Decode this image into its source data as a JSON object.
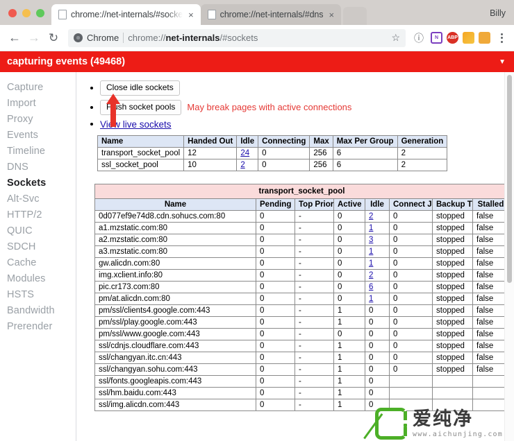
{
  "window": {
    "profile_name": "Billy",
    "traffic_lights": [
      "close",
      "minimize",
      "maximize"
    ]
  },
  "tabs": [
    {
      "title": "chrome://net-internals/#socke",
      "active": true,
      "close_label": "×"
    },
    {
      "title": "chrome://net-internals/#dns",
      "active": false,
      "close_label": "×"
    }
  ],
  "toolbar": {
    "back_icon": "←",
    "forward_icon": "→",
    "reload_icon": "↻",
    "omnibox": {
      "scheme_label": "Chrome",
      "url_prefix": "chrome://",
      "url_bold": "net-internals",
      "url_suffix": "/#sockets",
      "full_url": "chrome://net-internals/#sockets",
      "star_icon": "☆"
    },
    "info_icon": "ⓘ",
    "extensions": [
      {
        "name": "extension-purple",
        "label": "N",
        "color": "#7b3fbf"
      },
      {
        "name": "extension-adblock-plus",
        "label": "ABP",
        "color": "#d93025"
      },
      {
        "name": "extension-chart",
        "label": "",
        "color": "#f5a623"
      },
      {
        "name": "extension-pumpkin",
        "label": "",
        "color": "#f0a93a"
      }
    ],
    "menu_icon": "kebab-menu"
  },
  "banner": {
    "text": "capturing events (49468)",
    "caret": "▼",
    "color": "#ed1c16"
  },
  "sidebar": {
    "items": [
      {
        "label": "Capture",
        "active": false
      },
      {
        "label": "Import",
        "active": false
      },
      {
        "label": "Proxy",
        "active": false
      },
      {
        "label": "Events",
        "active": false
      },
      {
        "label": "Timeline",
        "active": false
      },
      {
        "label": "DNS",
        "active": false
      },
      {
        "label": "Sockets",
        "active": true
      },
      {
        "label": "Alt-Svc",
        "active": false
      },
      {
        "label": "HTTP/2",
        "active": false
      },
      {
        "label": "QUIC",
        "active": false
      },
      {
        "label": "SDCH",
        "active": false
      },
      {
        "label": "Cache",
        "active": false
      },
      {
        "label": "Modules",
        "active": false
      },
      {
        "label": "HSTS",
        "active": false
      },
      {
        "label": "Bandwidth",
        "active": false
      },
      {
        "label": "Prerender",
        "active": false
      }
    ]
  },
  "actions": {
    "close_idle_sockets": "Close idle sockets",
    "flush_socket_pools": "Flush socket pools",
    "flush_warning": "May break pages with active connections",
    "view_live_sockets": "View live sockets"
  },
  "pool_summary": {
    "headers": [
      "Name",
      "Handed Out",
      "Idle",
      "Connecting",
      "Max",
      "Max Per Group",
      "Generation"
    ],
    "rows": [
      {
        "name": "transport_socket_pool",
        "handed_out": "12",
        "idle": "24",
        "idle_link": true,
        "connecting": "0",
        "max": "256",
        "max_per_group": "6",
        "generation": "2"
      },
      {
        "name": "ssl_socket_pool",
        "handed_out": "10",
        "idle": "2",
        "idle_link": true,
        "connecting": "0",
        "max": "256",
        "max_per_group": "6",
        "generation": "2"
      }
    ]
  },
  "socket_table": {
    "caption": "transport_socket_pool",
    "headers": [
      "Name",
      "Pending",
      "Top Priority",
      "Active",
      "Idle",
      "Connect Jobs",
      "Backup Timer",
      "Stalled"
    ],
    "rows": [
      {
        "name": "0d077ef9e74d8.cdn.sohucs.com:80",
        "pending": "0",
        "top_priority": "-",
        "active": "0",
        "idle": "2",
        "idle_link": true,
        "connect_jobs": "0",
        "backup_timer": "stopped",
        "stalled": "false"
      },
      {
        "name": "a1.mzstatic.com:80",
        "pending": "0",
        "top_priority": "-",
        "active": "0",
        "idle": "1",
        "idle_link": true,
        "connect_jobs": "0",
        "backup_timer": "stopped",
        "stalled": "false"
      },
      {
        "name": "a2.mzstatic.com:80",
        "pending": "0",
        "top_priority": "-",
        "active": "0",
        "idle": "3",
        "idle_link": true,
        "connect_jobs": "0",
        "backup_timer": "stopped",
        "stalled": "false"
      },
      {
        "name": "a3.mzstatic.com:80",
        "pending": "0",
        "top_priority": "-",
        "active": "0",
        "idle": "1",
        "idle_link": true,
        "connect_jobs": "0",
        "backup_timer": "stopped",
        "stalled": "false"
      },
      {
        "name": "gw.alicdn.com:80",
        "pending": "0",
        "top_priority": "-",
        "active": "0",
        "idle": "1",
        "idle_link": true,
        "connect_jobs": "0",
        "backup_timer": "stopped",
        "stalled": "false"
      },
      {
        "name": "img.xclient.info:80",
        "pending": "0",
        "top_priority": "-",
        "active": "0",
        "idle": "2",
        "idle_link": true,
        "connect_jobs": "0",
        "backup_timer": "stopped",
        "stalled": "false"
      },
      {
        "name": "pic.cr173.com:80",
        "pending": "0",
        "top_priority": "-",
        "active": "0",
        "idle": "6",
        "idle_link": true,
        "connect_jobs": "0",
        "backup_timer": "stopped",
        "stalled": "false"
      },
      {
        "name": "pm/at.alicdn.com:80",
        "pending": "0",
        "top_priority": "-",
        "active": "0",
        "idle": "1",
        "idle_link": true,
        "connect_jobs": "0",
        "backup_timer": "stopped",
        "stalled": "false"
      },
      {
        "name": "pm/ssl/clients4.google.com:443",
        "pending": "0",
        "top_priority": "-",
        "active": "1",
        "idle": "0",
        "idle_link": false,
        "connect_jobs": "0",
        "backup_timer": "stopped",
        "stalled": "false"
      },
      {
        "name": "pm/ssl/play.google.com:443",
        "pending": "0",
        "top_priority": "-",
        "active": "1",
        "idle": "0",
        "idle_link": false,
        "connect_jobs": "0",
        "backup_timer": "stopped",
        "stalled": "false"
      },
      {
        "name": "pm/ssl/www.google.com:443",
        "pending": "0",
        "top_priority": "-",
        "active": "0",
        "idle": "0",
        "idle_link": false,
        "connect_jobs": "0",
        "backup_timer": "stopped",
        "stalled": "false"
      },
      {
        "name": "ssl/cdnjs.cloudflare.com:443",
        "pending": "0",
        "top_priority": "-",
        "active": "1",
        "idle": "0",
        "idle_link": false,
        "connect_jobs": "0",
        "backup_timer": "stopped",
        "stalled": "false"
      },
      {
        "name": "ssl/changyan.itc.cn:443",
        "pending": "0",
        "top_priority": "-",
        "active": "1",
        "idle": "0",
        "idle_link": false,
        "connect_jobs": "0",
        "backup_timer": "stopped",
        "stalled": "false"
      },
      {
        "name": "ssl/changyan.sohu.com:443",
        "pending": "0",
        "top_priority": "-",
        "active": "1",
        "idle": "0",
        "idle_link": false,
        "connect_jobs": "0",
        "backup_timer": "stopped",
        "stalled": "false"
      },
      {
        "name": "ssl/fonts.googleapis.com:443",
        "pending": "0",
        "top_priority": "-",
        "active": "1",
        "idle": "0",
        "idle_link": false,
        "connect_jobs": "",
        "backup_timer": "",
        "stalled": ""
      },
      {
        "name": "ssl/hm.baidu.com:443",
        "pending": "0",
        "top_priority": "-",
        "active": "1",
        "idle": "0",
        "idle_link": false,
        "connect_jobs": "",
        "backup_timer": "",
        "stalled": ""
      },
      {
        "name": "ssl/img.alicdn.com:443",
        "pending": "0",
        "top_priority": "-",
        "active": "1",
        "idle": "0",
        "idle_link": false,
        "connect_jobs": "",
        "backup_timer": "",
        "stalled": ""
      }
    ]
  },
  "watermark": {
    "text_cn": "爱纯净",
    "url": "www.aichunjing.com",
    "color": "#4caf27"
  }
}
